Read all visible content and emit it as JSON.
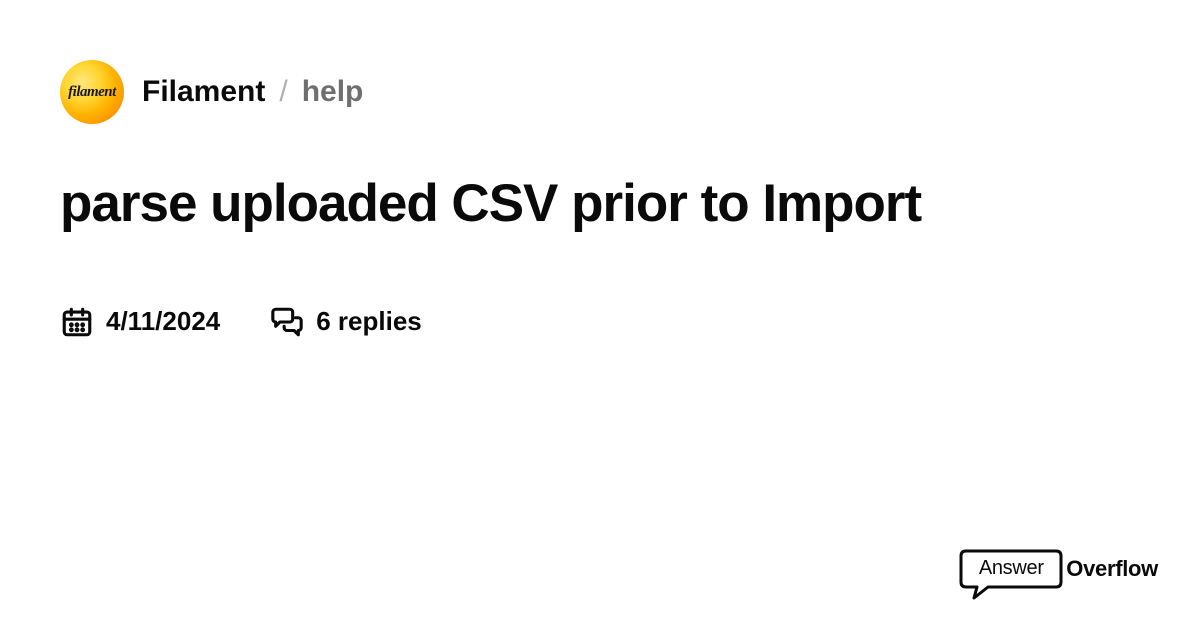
{
  "header": {
    "avatar_label": "filament",
    "community": "Filament",
    "separator": "/",
    "channel": "help"
  },
  "post": {
    "title": "parse uploaded CSV prior to Import",
    "date": "4/11/2024",
    "replies": "6 replies"
  },
  "brand": {
    "word1": "Answer",
    "word2": "Overflow"
  }
}
